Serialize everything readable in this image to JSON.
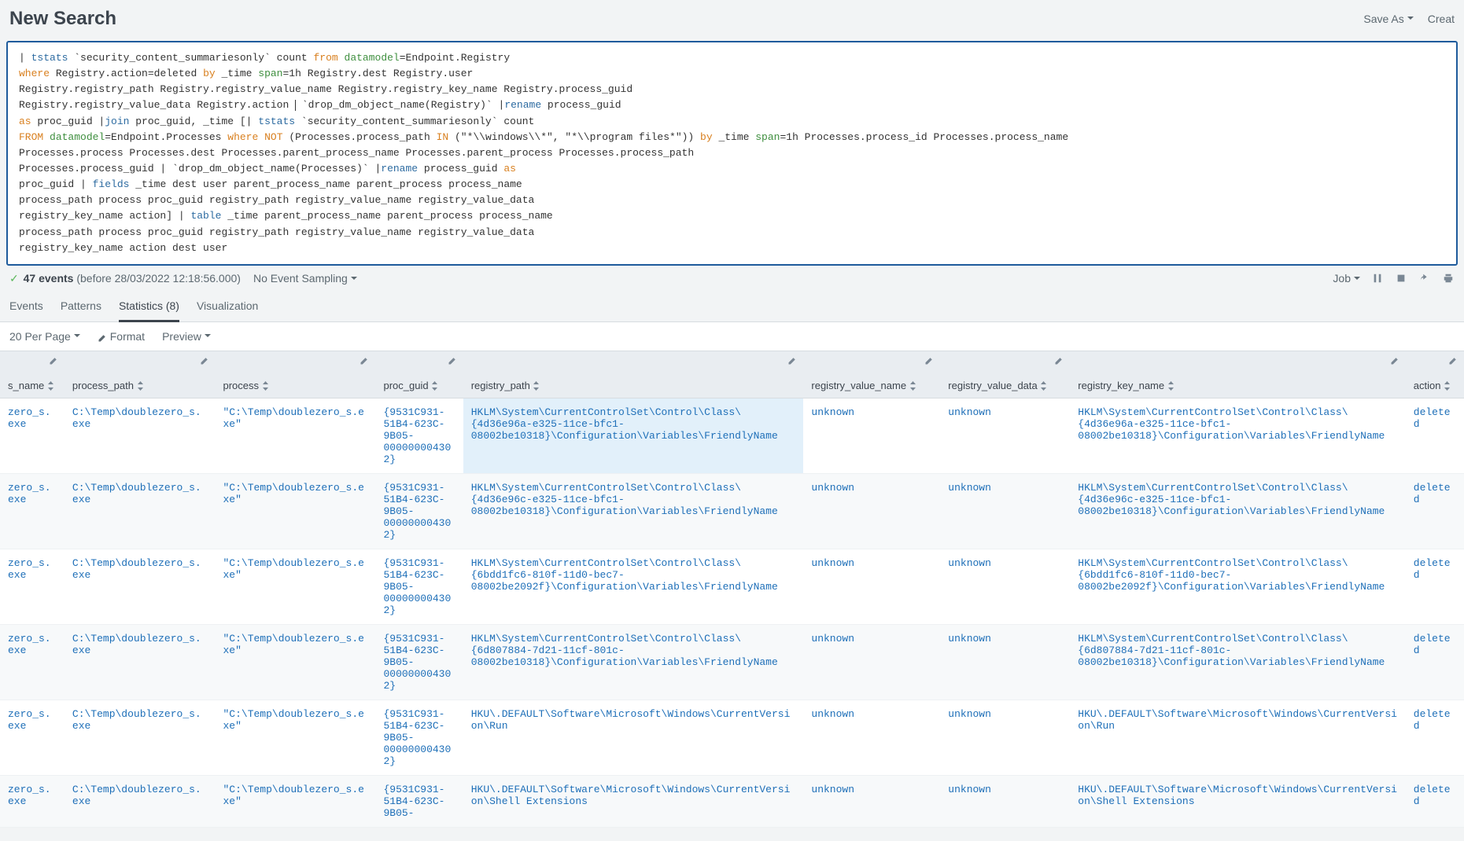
{
  "header": {
    "title": "New Search",
    "save_as": "Save As",
    "create": "Creat"
  },
  "search_tokens": [
    {
      "t": "| ",
      "c": ""
    },
    {
      "t": "tstats",
      "c": "tok-cmd"
    },
    {
      "t": " `security_content_summariesonly` count ",
      "c": ""
    },
    {
      "t": "from",
      "c": "tok-key"
    },
    {
      "t": " ",
      "c": ""
    },
    {
      "t": "datamodel",
      "c": "tok-green"
    },
    {
      "t": "=Endpoint.Registry\n",
      "c": ""
    },
    {
      "t": "where",
      "c": "tok-key"
    },
    {
      "t": " Registry.action=deleted ",
      "c": ""
    },
    {
      "t": "by",
      "c": "tok-key"
    },
    {
      "t": " _time ",
      "c": ""
    },
    {
      "t": "span",
      "c": "tok-green"
    },
    {
      "t": "=1h Registry.dest Registry.user\n",
      "c": ""
    },
    {
      "t": "Registry.registry_path Registry.registry_value_name Registry.registry_key_name Registry.process_guid\n",
      "c": ""
    },
    {
      "t": "Registry.registry_value_data Registry.action ",
      "c": ""
    },
    {
      "t": "",
      "c": "cursor"
    },
    {
      "t": " `drop_dm_object_name(Registry)` |",
      "c": ""
    },
    {
      "t": "rename",
      "c": "tok-cmd"
    },
    {
      "t": " process_guid\n",
      "c": ""
    },
    {
      "t": "as",
      "c": "tok-key"
    },
    {
      "t": " proc_guid |",
      "c": ""
    },
    {
      "t": "join",
      "c": "tok-cmd"
    },
    {
      "t": " proc_guid, _time [| ",
      "c": ""
    },
    {
      "t": "tstats",
      "c": "tok-cmd"
    },
    {
      "t": " `security_content_summariesonly` count\n",
      "c": ""
    },
    {
      "t": "FROM",
      "c": "tok-key"
    },
    {
      "t": " ",
      "c": ""
    },
    {
      "t": "datamodel",
      "c": "tok-green"
    },
    {
      "t": "=Endpoint.Processes ",
      "c": ""
    },
    {
      "t": "where",
      "c": "tok-key"
    },
    {
      "t": " ",
      "c": ""
    },
    {
      "t": "NOT",
      "c": "tok-key"
    },
    {
      "t": " (Processes.process_path ",
      "c": ""
    },
    {
      "t": "IN",
      "c": "tok-key"
    },
    {
      "t": " (\"*\\\\windows\\\\*\", \"*\\\\program files*\")) ",
      "c": ""
    },
    {
      "t": "by",
      "c": "tok-key"
    },
    {
      "t": " _time ",
      "c": ""
    },
    {
      "t": "span",
      "c": "tok-green"
    },
    {
      "t": "=1h Processes.process_id Processes.process_name\n",
      "c": ""
    },
    {
      "t": "Processes.process Processes.dest Processes.parent_process_name Processes.parent_process Processes.process_path\n",
      "c": ""
    },
    {
      "t": "Processes.process_guid | `drop_dm_object_name(Processes)` |",
      "c": ""
    },
    {
      "t": "rename",
      "c": "tok-cmd"
    },
    {
      "t": " process_guid ",
      "c": ""
    },
    {
      "t": "as",
      "c": "tok-key"
    },
    {
      "t": "\n",
      "c": ""
    },
    {
      "t": "proc_guid | ",
      "c": ""
    },
    {
      "t": "fields",
      "c": "tok-cmd"
    },
    {
      "t": " _time dest user parent_process_name parent_process process_name\n",
      "c": ""
    },
    {
      "t": "process_path process proc_guid registry_path registry_value_name registry_value_data\n",
      "c": ""
    },
    {
      "t": "registry_key_name action] | ",
      "c": ""
    },
    {
      "t": "table",
      "c": "tok-cmd"
    },
    {
      "t": " _time parent_process_name parent_process process_name\n",
      "c": ""
    },
    {
      "t": "process_path process proc_guid registry_path registry_value_name registry_value_data\n",
      "c": ""
    },
    {
      "t": "registry_key_name action dest user",
      "c": ""
    }
  ],
  "status": {
    "events_count": "47 events",
    "events_meta": "(before 28/03/2022 12:18:56.000)",
    "sampling": "No Event Sampling",
    "job": "Job"
  },
  "tabs": {
    "events": "Events",
    "patterns": "Patterns",
    "statistics": "Statistics (8)",
    "visualization": "Visualization"
  },
  "toolbar": {
    "per_page": "20 Per Page",
    "format": "Format",
    "preview": "Preview"
  },
  "columns": [
    {
      "key": "s_name",
      "label": "s_name"
    },
    {
      "key": "process_path",
      "label": "process_path"
    },
    {
      "key": "process",
      "label": "process"
    },
    {
      "key": "proc_guid",
      "label": "proc_guid"
    },
    {
      "key": "registry_path",
      "label": "registry_path"
    },
    {
      "key": "registry_value_name",
      "label": "registry_value_name"
    },
    {
      "key": "registry_value_data",
      "label": "registry_value_data"
    },
    {
      "key": "registry_key_name",
      "label": "registry_key_name"
    },
    {
      "key": "action",
      "label": "action"
    }
  ],
  "rows": [
    {
      "s_name": "zero_s.exe",
      "process_path": "C:\\Temp\\doublezero_s.exe",
      "process": "\"C:\\Temp\\doublezero_s.exe\"",
      "proc_guid": "{9531C931-51B4-623C-9B05-000000004302}",
      "registry_path": "HKLM\\System\\CurrentControlSet\\Control\\Class\\{4d36e96a-e325-11ce-bfc1-08002be10318}\\Configuration\\Variables\\FriendlyName",
      "registry_value_name": "unknown",
      "registry_value_data": "unknown",
      "registry_key_name": "HKLM\\System\\CurrentControlSet\\Control\\Class\\{4d36e96a-e325-11ce-bfc1-08002be10318}\\Configuration\\Variables\\FriendlyName",
      "action": "deleted",
      "highlight": "registry_path"
    },
    {
      "s_name": "zero_s.exe",
      "process_path": "C:\\Temp\\doublezero_s.exe",
      "process": "\"C:\\Temp\\doublezero_s.exe\"",
      "proc_guid": "{9531C931-51B4-623C-9B05-000000004302}",
      "registry_path": "HKLM\\System\\CurrentControlSet\\Control\\Class\\{4d36e96c-e325-11ce-bfc1-08002be10318}\\Configuration\\Variables\\FriendlyName",
      "registry_value_name": "unknown",
      "registry_value_data": "unknown",
      "registry_key_name": "HKLM\\System\\CurrentControlSet\\Control\\Class\\{4d36e96c-e325-11ce-bfc1-08002be10318}\\Configuration\\Variables\\FriendlyName",
      "action": "deleted"
    },
    {
      "s_name": "zero_s.exe",
      "process_path": "C:\\Temp\\doublezero_s.exe",
      "process": "\"C:\\Temp\\doublezero_s.exe\"",
      "proc_guid": "{9531C931-51B4-623C-9B05-000000004302}",
      "registry_path": "HKLM\\System\\CurrentControlSet\\Control\\Class\\{6bdd1fc6-810f-11d0-bec7-08002be2092f}\\Configuration\\Variables\\FriendlyName",
      "registry_value_name": "unknown",
      "registry_value_data": "unknown",
      "registry_key_name": "HKLM\\System\\CurrentControlSet\\Control\\Class\\{6bdd1fc6-810f-11d0-bec7-08002be2092f}\\Configuration\\Variables\\FriendlyName",
      "action": "deleted"
    },
    {
      "s_name": "zero_s.exe",
      "process_path": "C:\\Temp\\doublezero_s.exe",
      "process": "\"C:\\Temp\\doublezero_s.exe\"",
      "proc_guid": "{9531C931-51B4-623C-9B05-000000004302}",
      "registry_path": "HKLM\\System\\CurrentControlSet\\Control\\Class\\{6d807884-7d21-11cf-801c-08002be10318}\\Configuration\\Variables\\FriendlyName",
      "registry_value_name": "unknown",
      "registry_value_data": "unknown",
      "registry_key_name": "HKLM\\System\\CurrentControlSet\\Control\\Class\\{6d807884-7d21-11cf-801c-08002be10318}\\Configuration\\Variables\\FriendlyName",
      "action": "deleted"
    },
    {
      "s_name": "zero_s.exe",
      "process_path": "C:\\Temp\\doublezero_s.exe",
      "process": "\"C:\\Temp\\doublezero_s.exe\"",
      "proc_guid": "{9531C931-51B4-623C-9B05-000000004302}",
      "registry_path": "HKU\\.DEFAULT\\Software\\Microsoft\\Windows\\CurrentVersion\\Run",
      "registry_value_name": "unknown",
      "registry_value_data": "unknown",
      "registry_key_name": "HKU\\.DEFAULT\\Software\\Microsoft\\Windows\\CurrentVersion\\Run",
      "action": "deleted"
    },
    {
      "s_name": "zero_s.exe",
      "process_path": "C:\\Temp\\doublezero_s.exe",
      "process": "\"C:\\Temp\\doublezero_s.exe\"",
      "proc_guid": "{9531C931-51B4-623C-9B05-",
      "registry_path": "HKU\\.DEFAULT\\Software\\Microsoft\\Windows\\CurrentVersion\\Shell Extensions",
      "registry_value_name": "unknown",
      "registry_value_data": "unknown",
      "registry_key_name": "HKU\\.DEFAULT\\Software\\Microsoft\\Windows\\CurrentVersion\\Shell Extensions",
      "action": "deleted"
    }
  ]
}
